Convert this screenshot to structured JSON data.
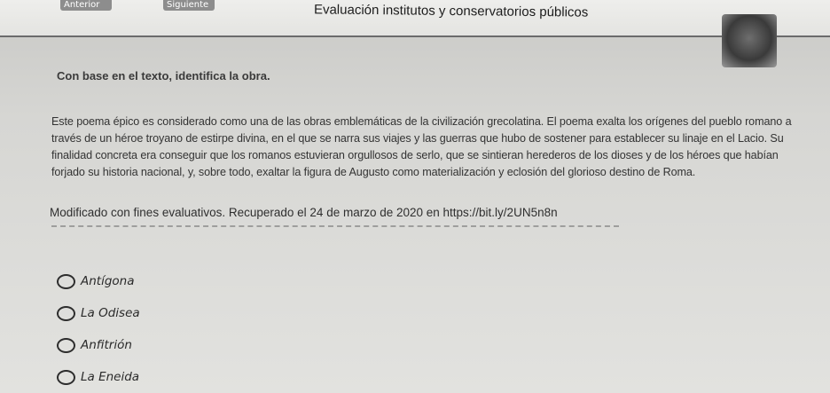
{
  "header": {
    "prev_label": "Anterior",
    "next_label": "Siguiente",
    "title": "Evaluación institutos y conservatorios públicos"
  },
  "question": {
    "instruction": "Con base en el texto, identifica la obra.",
    "passage": "Este poema épico es considerado como una de las obras emblemáticas de la civilización grecolatina. El poema exalta los orígenes del pueblo romano a través de un héroe troyano de estirpe divina, en el que se narra sus viajes y las guerras que hubo de sostener para establecer su linaje en el Lacio. Su finalidad concreta era conseguir que los romanos estuvieran orgullosos de serlo, que se sintieran herederos de los dioses y de los héroes que habían forjado su historia nacional, y, sobre todo, exaltar la figura de Augusto como materialización y eclosión del glorioso destino de Roma.",
    "source": "Modificado con fines evaluativos. Recuperado el 24 de marzo de 2020 en https://bit.ly/2UN5n8n"
  },
  "options": [
    {
      "label": "Antígona"
    },
    {
      "label": "La Odisea"
    },
    {
      "label": "Anfitrión"
    },
    {
      "label": "La Eneida"
    }
  ]
}
